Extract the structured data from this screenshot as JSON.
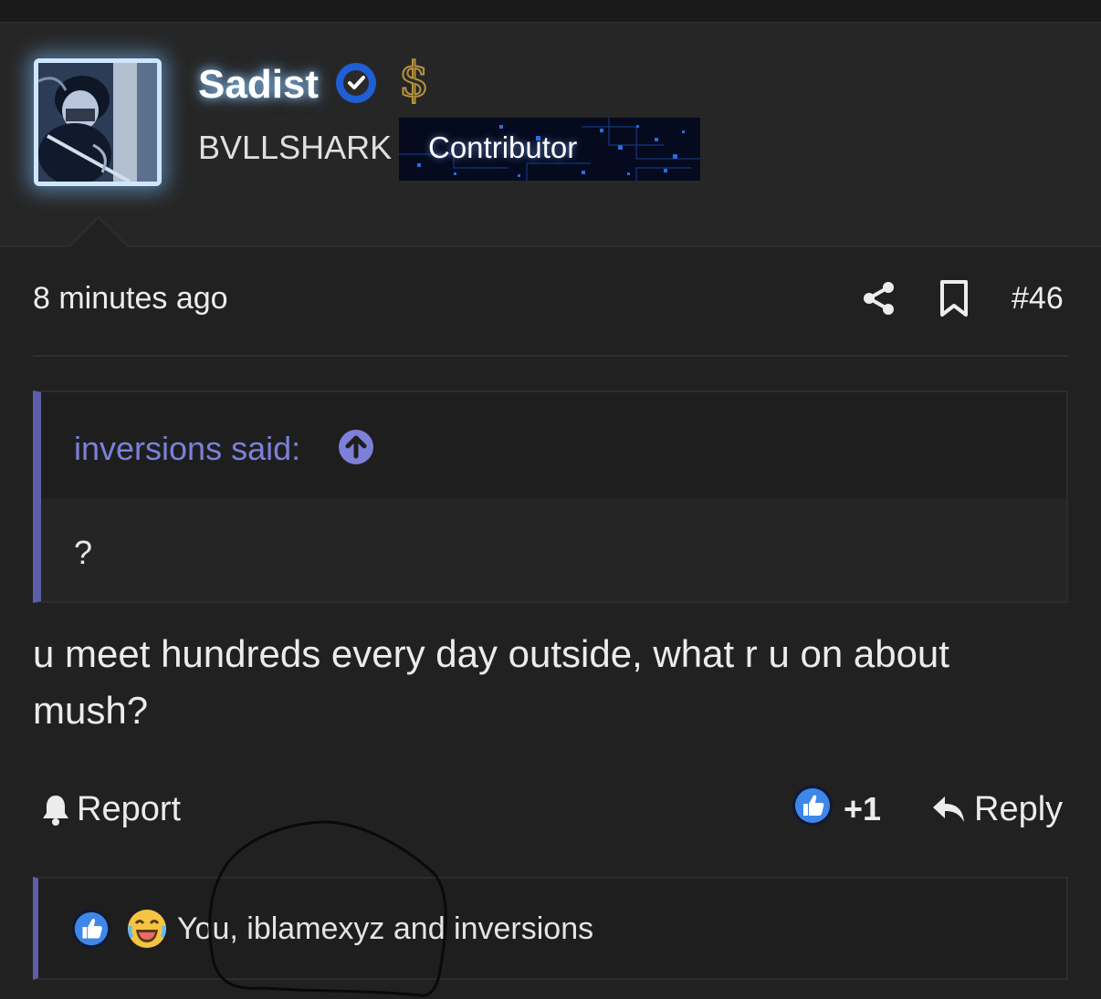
{
  "post": {
    "username": "Sadist",
    "user_title": "BVLLSHARK",
    "badge": "Contributor",
    "time": "8 minutes ago",
    "post_number": "#46",
    "message": "u meet hundreds every day outside, what r u on about mush?"
  },
  "quote": {
    "author": "inversions said:",
    "body": "?"
  },
  "actions": {
    "report_label": "Report",
    "like_count": "+1",
    "reply_label": "Reply"
  },
  "reactions": {
    "text": "You, iblamexyz and inversions"
  },
  "colors": {
    "background": "#212121",
    "accent": "#5c5fa8",
    "quote_author": "#7c80d8",
    "verified": "#1f5fd6",
    "glow": "#8cc8ff"
  },
  "icons": [
    "verified-icon",
    "dollar-icon",
    "share-icon",
    "bookmark-icon",
    "quote-up-arrow-icon",
    "bell-icon",
    "thumbs-up-icon",
    "reply-icon",
    "laughing-emoji-icon"
  ]
}
